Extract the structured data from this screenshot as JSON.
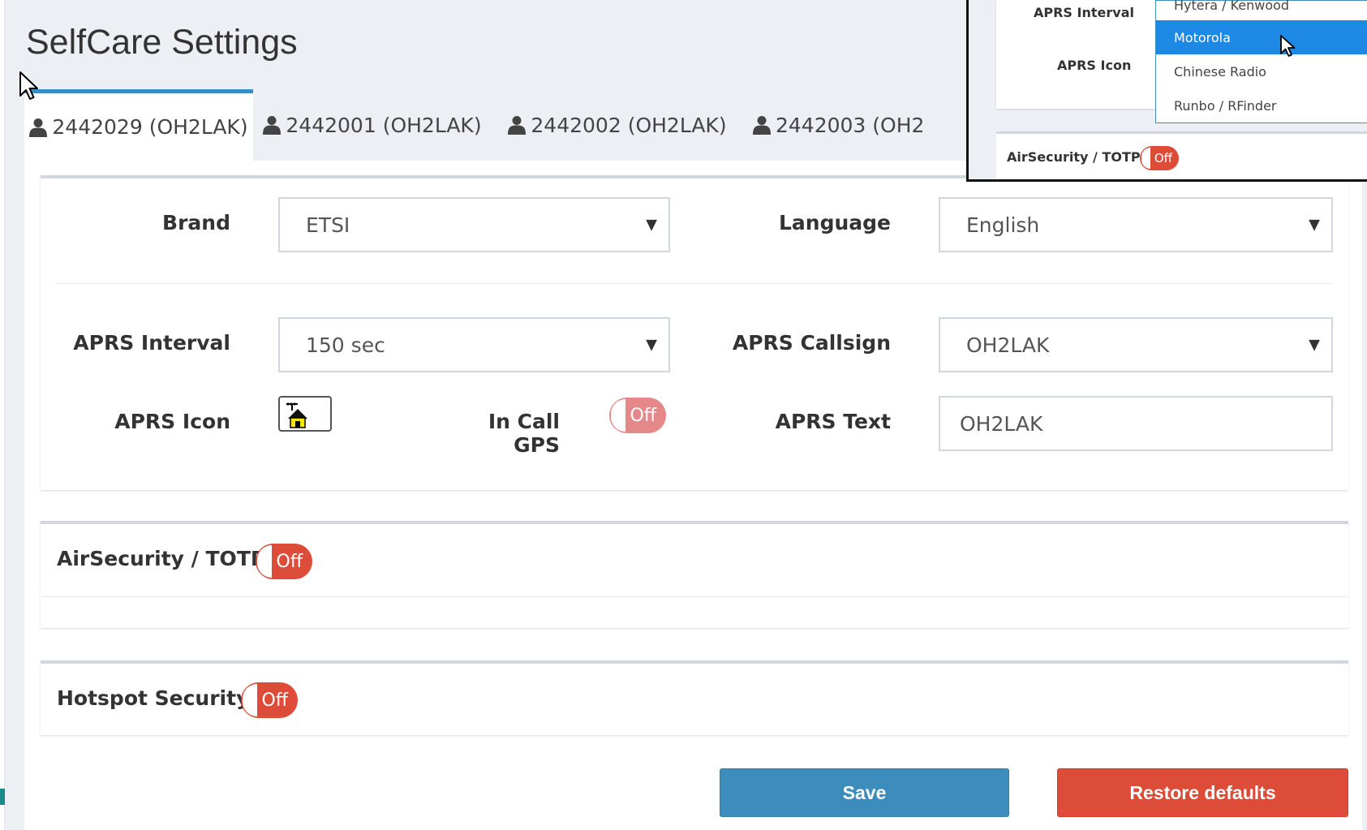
{
  "page": {
    "title": "SelfCare Settings"
  },
  "tabs": [
    {
      "label": "2442029 (OH2LAK)",
      "active": true
    },
    {
      "label": "2442001 (OH2LAK)",
      "active": false
    },
    {
      "label": "2442002 (OH2LAK)",
      "active": false
    },
    {
      "label": "2442003 (OH2",
      "active": false
    }
  ],
  "settings": {
    "brand_label": "Brand",
    "brand_value": "ETSI",
    "language_label": "Language",
    "language_value": "English",
    "aprs_interval_label": "APRS Interval",
    "aprs_interval_value": "150 sec",
    "aprs_callsign_label": "APRS Callsign",
    "aprs_callsign_value": "OH2LAK",
    "aprs_icon_label": "APRS Icon",
    "in_call_gps_label": "In Call GPS",
    "in_call_gps_state": "Off",
    "aprs_text_label": "APRS Text",
    "aprs_text_value": "OH2LAK"
  },
  "airsecurity": {
    "label": "AirSecurity / TOTP",
    "state": "Off"
  },
  "hotspot": {
    "label": "Hotspot Security",
    "state": "Off"
  },
  "buttons": {
    "save": "Save",
    "restore": "Restore defaults"
  },
  "overlay": {
    "aprs_interval_label": "APRS Interval",
    "aprs_icon_label": "APRS Icon",
    "brand_options": [
      "Hytera / Kenwood",
      "Motorola",
      "Chinese Radio",
      "Runbo / RFinder"
    ],
    "selected_option": "Motorola",
    "airsecurity_label": "AirSecurity / TOTP",
    "airsecurity_state": "Off"
  },
  "colors": {
    "primary": "#3c8dbc",
    "danger": "#dd4b39",
    "selected_option": "#1e88e5",
    "page_bg": "#ecf0f5"
  }
}
